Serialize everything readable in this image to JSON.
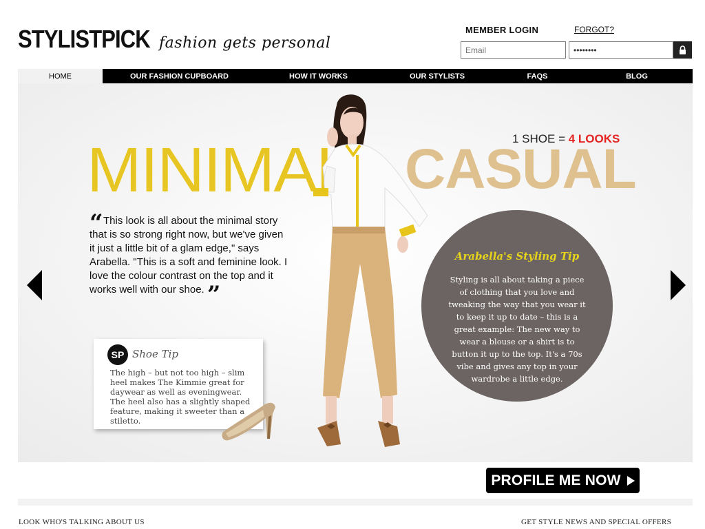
{
  "brand": {
    "name": "STYLISTPICK",
    "tagline": "fashion gets personal"
  },
  "login": {
    "title": "MEMBER LOGIN",
    "forgot": "FORGOT?",
    "email_placeholder": "Email",
    "password_value": "••••••••"
  },
  "nav": {
    "items": [
      {
        "label": "HOME",
        "active": true
      },
      {
        "label": "OUR FASHION CUPBOARD",
        "active": false
      },
      {
        "label": "HOW IT WORKS",
        "active": false
      },
      {
        "label": "OUR STYLISTS",
        "active": false
      },
      {
        "label": "FAQS",
        "active": false
      },
      {
        "label": "BLOG",
        "active": false
      }
    ]
  },
  "hero": {
    "title_left": "MINIMAL",
    "title_right": "CASUAL",
    "promo_prefix": "1 SHOE = ",
    "promo_highlight": "4 LOOKS",
    "quote": "This look is all about the minimal story that is so strong right now, but we've given it just a little bit of a glam edge,\" says Arabella. \"This is a soft and feminine look. I love the colour contrast on the top and it works well with our shoe.",
    "shoe_tip": {
      "badge": "SP",
      "title": "Shoe Tip",
      "body": "The high – but not too high – slim heel makes The Kimmie great for daywear as well as eveningwear. The heel also has a slightly shaped feature, making it sweeter than a stiletto."
    },
    "styling_tip": {
      "title": "Arabella's Styling Tip",
      "body": "Styling is all about taking a piece of clothing that you love and tweaking the way that you wear it to keep it up to date – this is a great example: The new way to wear a blouse or a shirt is to button it up to the top. It's a 70s vibe and gives any top in your wardrobe a little edge."
    }
  },
  "cta": {
    "label": "PROFILE ME NOW"
  },
  "footer": {
    "left": "LOOK WHO'S TALKING ABOUT US",
    "right": "GET STYLE NEWS AND SPECIAL OFFERS"
  },
  "colors": {
    "minimal_yellow": "#e7c522",
    "casual_tan": "#dfc08f",
    "promo_red": "#e52323",
    "tip_circle": "#6c6463",
    "tip_title_yellow": "#e7d41a",
    "nav_bg": "#000000"
  },
  "icons": {
    "login_button": "lock-icon",
    "prev": "arrow-left-icon",
    "next": "arrow-right-icon",
    "cta": "play-arrow-icon"
  }
}
